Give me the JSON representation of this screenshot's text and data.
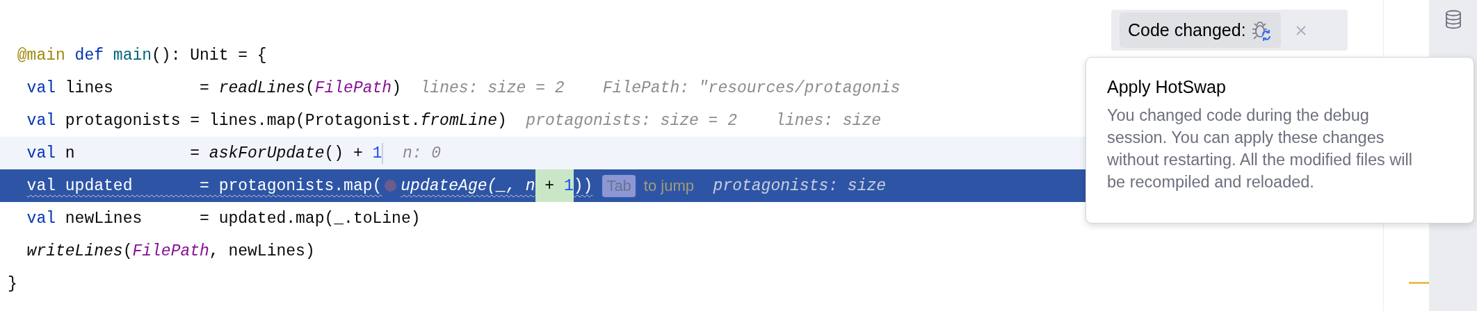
{
  "code": {
    "header": {
      "segments": [
        {
          "kind": "annotation",
          "text": "@main"
        },
        {
          "kind": "keyword",
          "text": " def"
        },
        {
          "kind": "decl",
          "text": " main"
        },
        {
          "kind": "text",
          "text": "(): Unit = {"
        }
      ]
    },
    "body": [
      {
        "selected": false,
        "current": false,
        "segments": [
          {
            "kind": "keyword",
            "text": "val"
          },
          {
            "kind": "text",
            "text": " lines         = "
          },
          {
            "kind": "call",
            "text": "readLines"
          },
          {
            "kind": "text",
            "text": "("
          },
          {
            "kind": "const",
            "text": "FilePath"
          },
          {
            "kind": "text",
            "text": ")"
          },
          {
            "kind": "hint",
            "text": "lines: size = 2"
          },
          {
            "kind": "hint",
            "text": "FilePath: \"resources/protagonis"
          }
        ]
      },
      {
        "selected": false,
        "current": false,
        "segments": [
          {
            "kind": "keyword",
            "text": "val"
          },
          {
            "kind": "text",
            "text": " protagonists = lines.map(Protagonist."
          },
          {
            "kind": "call",
            "text": "fromLine"
          },
          {
            "kind": "text",
            "text": ")"
          },
          {
            "kind": "hint",
            "text": "protagonists: size = 2"
          },
          {
            "kind": "hint",
            "text": "lines: size"
          }
        ]
      },
      {
        "selected": false,
        "current": true,
        "segments": [
          {
            "kind": "keyword",
            "text": "val"
          },
          {
            "kind": "text",
            "text": " n            = "
          },
          {
            "kind": "call",
            "text": "askForUpdate"
          },
          {
            "kind": "text",
            "text": "() + "
          },
          {
            "kind": "number",
            "text": "1"
          },
          {
            "kind": "hint",
            "text": "n: 0"
          }
        ]
      },
      {
        "selected": true,
        "current": false,
        "segments": [
          {
            "kind": "keyword",
            "text": "val",
            "squiggle": true
          },
          {
            "kind": "text",
            "text": " updated       = protagonists.map(",
            "squiggle": true
          },
          {
            "kind": "dot"
          },
          {
            "kind": "call",
            "text": "updateAge(_, n",
            "squiggle": true
          },
          {
            "kind": "text",
            "text": " + ",
            "inserted": true
          },
          {
            "kind": "number",
            "text": "1",
            "inserted": true
          },
          {
            "kind": "text",
            "text": "))",
            "squiggle": true
          },
          {
            "kind": "key",
            "text": "Tab"
          },
          {
            "kind": "note",
            "text": "to jump"
          },
          {
            "kind": "hint",
            "text": "protagonists: size"
          }
        ]
      },
      {
        "selected": false,
        "current": false,
        "segments": [
          {
            "kind": "keyword",
            "text": "val"
          },
          {
            "kind": "text",
            "text": " newLines      = updated.map(_.toLine)"
          }
        ]
      },
      {
        "selected": false,
        "current": false,
        "segments": [
          {
            "kind": "call",
            "text": "writeLines"
          },
          {
            "kind": "text",
            "text": "("
          },
          {
            "kind": "const",
            "text": "FilePath"
          },
          {
            "kind": "text",
            "text": ", newLines)"
          }
        ]
      }
    ],
    "footer": {
      "segments": [
        {
          "kind": "text",
          "text": "}"
        }
      ]
    }
  },
  "code_changed": {
    "label": "Code changed:"
  },
  "popup": {
    "title": "Apply HotSwap",
    "body": "You changed code during the debug session. You can apply these changes without restarting. All the modified files will be recompiled and reloaded."
  }
}
